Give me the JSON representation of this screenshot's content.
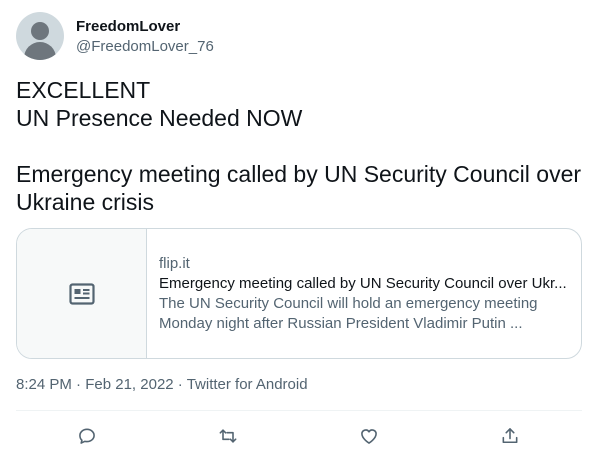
{
  "author": {
    "display_name": "FreedomLover",
    "handle": "@FreedomLover_76"
  },
  "tweet": {
    "lines": [
      "EXCELLENT",
      "UN Presence Needed NOW",
      "",
      "Emergency meeting called by UN Security Council over",
      "Ukraine crisis"
    ]
  },
  "card": {
    "domain": "flip.it",
    "title": "Emergency meeting called by UN Security Council over Ukr...",
    "description_line1": "The UN Security Council will hold an emergency meeting",
    "description_line2": "Monday night after Russian President Vladimir Putin ..."
  },
  "meta": {
    "time": "8:24 PM",
    "sep1": " · ",
    "date": "Feb 21, 2022",
    "sep2": " · ",
    "source": "Twitter for Android"
  },
  "actions": {
    "icons": [
      "reply-icon",
      "retweet-icon",
      "like-icon",
      "share-icon"
    ]
  },
  "colors": {
    "text_primary": "#0f1419",
    "text_secondary": "#536471",
    "border": "#cfd9de",
    "avatar_bg": "#cfd9de"
  }
}
